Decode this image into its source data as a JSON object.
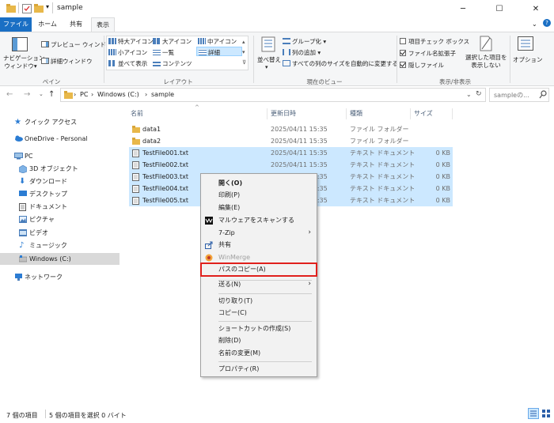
{
  "window": {
    "title": "sample",
    "minimize": "─",
    "maximize": "☐",
    "close": "✕"
  },
  "tabs": [
    "ファイル",
    "ホーム",
    "共有",
    "表示"
  ],
  "ribbon": {
    "pane": {
      "navigation_pane": "ナビゲーション",
      "navigation_pane_2": "ウィンドウ▾",
      "preview_pane": "プレビュー ウィンドウ",
      "details_pane": "詳細ウィンドウ",
      "group_label": "ペイン"
    },
    "layout": {
      "items": [
        "特大アイコン",
        "大アイコン",
        "中アイコン",
        "小アイコン",
        "一覧",
        "詳細",
        "並べて表示",
        "コンテンツ"
      ],
      "group_label": "レイアウト"
    },
    "current_view": {
      "sort_by": "並べ替え",
      "group_by": "グループ化 ▾",
      "add_columns": "列の追加 ▾",
      "size_all_columns": "すべての列のサイズを自動的に変更する",
      "group_label": "現在のビュー"
    },
    "show_hide": {
      "item_checkboxes": "項目チェック ボックス",
      "file_extensions": "ファイル名拡張子",
      "hidden_items": "隠しファイル",
      "hide_selected_1": "選択した項目を",
      "hide_selected_2": "表示しない",
      "group_label": "表示/非表示",
      "item_checkboxes_checked": false,
      "file_extensions_checked": true,
      "hidden_items_checked": true
    },
    "options": "オプション"
  },
  "address": {
    "path": [
      "PC",
      "Windows (C:)",
      "sample"
    ],
    "search_placeholder": "sampleの..."
  },
  "nav": {
    "items": [
      {
        "label": "クイック アクセス",
        "icon": "star-icon"
      },
      {
        "label": "OneDrive - Personal",
        "icon": "cloud-icon"
      },
      {
        "label": "PC",
        "icon": "pc-icon"
      },
      {
        "label": "3D オブジェクト",
        "icon": "cube-icon"
      },
      {
        "label": "ダウンロード",
        "icon": "download-icon"
      },
      {
        "label": "デスクトップ",
        "icon": "desktop-icon"
      },
      {
        "label": "ドキュメント",
        "icon": "document-icon"
      },
      {
        "label": "ピクチャ",
        "icon": "picture-icon"
      },
      {
        "label": "ビデオ",
        "icon": "video-icon"
      },
      {
        "label": "ミュージック",
        "icon": "music-icon"
      },
      {
        "label": "Windows (C:)",
        "icon": "drive-icon"
      },
      {
        "label": "ネットワーク",
        "icon": "network-icon"
      }
    ]
  },
  "list": {
    "columns": [
      "名前",
      "更新日時",
      "種類",
      "サイズ"
    ],
    "rows": [
      {
        "name": "data1",
        "date": "2025/04/11 15:35",
        "type": "ファイル フォルダー",
        "size": "",
        "folder": true,
        "selected": false
      },
      {
        "name": "data2",
        "date": "2025/04/11 15:35",
        "type": "ファイル フォルダー",
        "size": "",
        "folder": true,
        "selected": false
      },
      {
        "name": "TestFile001.txt",
        "date": "2025/04/11 15:35",
        "type": "テキスト ドキュメント",
        "size": "0 KB",
        "folder": false,
        "selected": true
      },
      {
        "name": "TestFile002.txt",
        "date": "2025/04/11 15:35",
        "type": "テキスト ドキュメント",
        "size": "0 KB",
        "folder": false,
        "selected": true
      },
      {
        "name": "TestFile003.txt",
        "date": "2025/04/11 15:35",
        "type": "テキスト ドキュメント",
        "size": "0 KB",
        "folder": false,
        "selected": true
      },
      {
        "name": "TestFile004.txt",
        "date": "2025/04/11 15:35",
        "type": "テキスト ドキュメント",
        "size": "0 KB",
        "folder": false,
        "selected": true
      },
      {
        "name": "TestFile005.txt",
        "date": "2025/04/11 15:35",
        "type": "テキスト ドキュメント",
        "size": "0 KB",
        "folder": false,
        "selected": true
      }
    ]
  },
  "context_menu": {
    "open": "開く(O)",
    "print": "印刷(P)",
    "edit": "編集(E)",
    "scan": "マルウェアをスキャンする",
    "sevenzip": "7-Zip",
    "share": "共有",
    "winmerge": "WinMerge",
    "copy_path": "パスのコピー(A)",
    "send_to": "送る(N)",
    "cut": "切り取り(T)",
    "copy": "コピー(C)",
    "create_shortcut": "ショートカットの作成(S)",
    "delete": "削除(D)",
    "rename": "名前の変更(M)",
    "properties": "プロパティ(R)"
  },
  "status": {
    "item_count": "7 個の項目",
    "selection": "5 個の項目を選択 0 バイト"
  },
  "colors": {
    "selection": "#cce8ff",
    "file_tab": "#1a6fc4",
    "highlight_box": "#e0201c",
    "folder": "#e8b84a"
  }
}
